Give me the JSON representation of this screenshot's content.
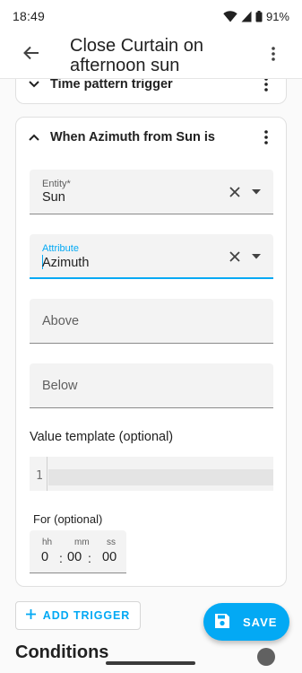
{
  "status_bar": {
    "time": "18:49",
    "battery": "91%"
  },
  "app_bar": {
    "title": "Close Curtain on afternoon sun"
  },
  "triggers": [
    {
      "title": "Time pattern trigger",
      "expanded": false
    },
    {
      "title": "When Azimuth from Sun is",
      "expanded": true,
      "entity": {
        "label": "Entity*",
        "value": "Sun"
      },
      "attribute": {
        "label": "Attribute",
        "value": "Azimuth"
      },
      "above": {
        "placeholder": "Above",
        "value": ""
      },
      "below": {
        "placeholder": "Below",
        "value": ""
      },
      "value_template": {
        "label": "Value template (optional)",
        "line_number": "1",
        "value": ""
      },
      "for": {
        "label": "For (optional)",
        "units": {
          "hours": "hh",
          "minutes": "mm",
          "seconds": "ss"
        },
        "hours": "0",
        "minutes": "00",
        "seconds": "00",
        "separator": ":"
      }
    }
  ],
  "add_trigger": {
    "label": "ADD TRIGGER",
    "icon": "plus-icon"
  },
  "next_section": {
    "title": "Conditions"
  },
  "save": {
    "label": "SAVE",
    "icon": "floppy-disk-icon"
  },
  "colors": {
    "accent": "#03a9f4",
    "field_bg": "#f3f3f3",
    "text": "#212121",
    "muted": "#5f5f5f"
  }
}
